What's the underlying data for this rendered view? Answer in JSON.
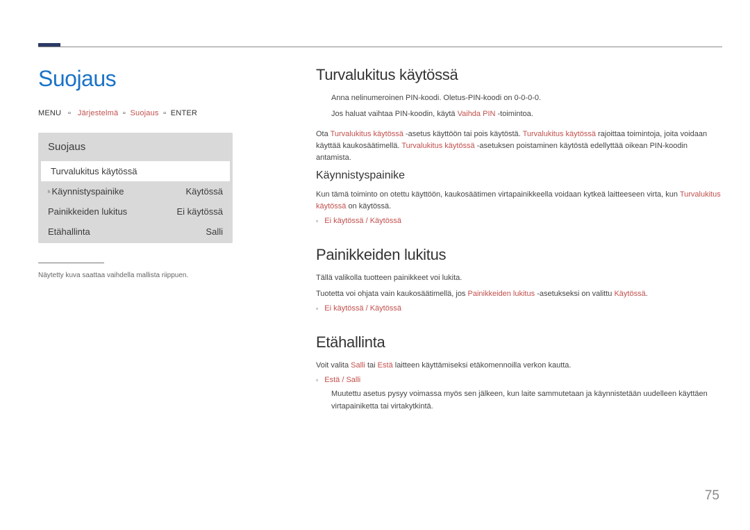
{
  "page_number": "75",
  "page_title": "Suojaus",
  "breadcrumb": {
    "menu": "MENU",
    "arrow": "▫",
    "system": "Järjestelmä",
    "security": "Suojaus",
    "enter": "ENTER"
  },
  "menu_panel": {
    "header": "Suojaus",
    "rows": [
      {
        "label": "Turvalukitus käytössä",
        "value": "",
        "selected": true,
        "indent": false
      },
      {
        "label": "Käynnistyspainike",
        "value": "Käytössä",
        "selected": false,
        "indent": true
      },
      {
        "label": "Painikkeiden lukitus",
        "value": "Ei käytössä",
        "selected": false,
        "indent": false
      },
      {
        "label": "Etähallinta",
        "value": "Salli",
        "selected": false,
        "indent": false
      }
    ]
  },
  "footnote": "Näytetty kuva saattaa vaihdella mallista riippuen.",
  "sections": {
    "safety_lock": {
      "title": "Turvalukitus käytössä",
      "note1": "Anna nelinumeroinen PIN-koodi. Oletus-PIN-koodi on 0-0-0-0.",
      "note2_pre": "Jos haluat vaihtaa PIN-koodin, käytä ",
      "note2_hl": "Vaihda PIN",
      "note2_post": " -toimintoa.",
      "body_p1": "Ota ",
      "body_hl1": "Turvalukitus käytössä",
      "body_p2": " -asetus käyttöön tai pois käytöstä. ",
      "body_hl2": "Turvalukitus käytössä",
      "body_p3": " rajoittaa toimintoja, joita voidaan käyttää kaukosäätimellä. ",
      "body_hl3": "Turvalukitus käytössä",
      "body_p4": " -asetuksen poistaminen käytöstä edellyttää oikean PIN-koodin antamista.",
      "sub": {
        "title": "Käynnistyspainike",
        "body_p1": "Kun tämä toiminto on otettu käyttöön, kaukosäätimen virtapainikkeella voidaan kytkeä laitteeseen virta, kun ",
        "body_hl1": "Turvalukitus käytössä",
        "body_p2": " on käytössä.",
        "opt1": "Ei käytössä",
        "opt_sep": " / ",
        "opt2": "Käytössä"
      }
    },
    "button_lock": {
      "title": "Painikkeiden lukitus",
      "body1": "Tällä valikolla tuotteen painikkeet voi lukita.",
      "body2_p1": "Tuotetta voi ohjata vain kaukosäätimellä, jos ",
      "body2_hl1": "Painikkeiden lukitus",
      "body2_p2": " -asetukseksi on valittu ",
      "body2_hl2": "Käytössä",
      "body2_p3": ".",
      "opt1": "Ei käytössä",
      "opt_sep": " / ",
      "opt2": "Käytössä"
    },
    "remote": {
      "title": "Etähallinta",
      "body1_p1": "Voit valita ",
      "body1_hl1": "Salli",
      "body1_p2": " tai ",
      "body1_hl2": "Estä",
      "body1_p3": " laitteen käyttämiseksi etäkomennoilla verkon kautta.",
      "opt1": "Estä",
      "opt_sep": " / ",
      "opt2": "Salli",
      "subnote": "Muutettu asetus pysyy voimassa myös sen jälkeen, kun laite sammutetaan ja käynnistetään uudelleen käyttäen virtapainiketta tai virtakytkintä."
    }
  }
}
